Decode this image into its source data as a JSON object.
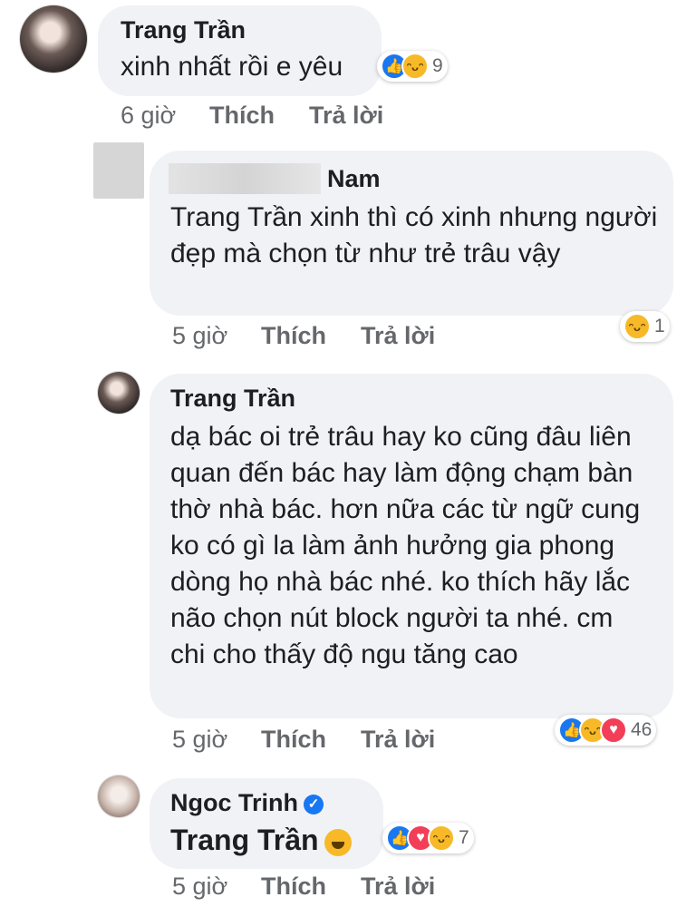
{
  "comments": [
    {
      "author": "Trang Trần",
      "text": "xinh nhất rồi e yêu",
      "time": "6 giờ",
      "like_label": "Thích",
      "reply_label": "Trả lời",
      "reaction_count": "9",
      "reactions": [
        "like-icon",
        "haha-icon"
      ]
    },
    {
      "author": "Nam",
      "text": "Trang Trần xinh thì có xinh nhưng người đẹp mà chọn từ như trẻ trâu vậy",
      "time": "5 giờ",
      "like_label": "Thích",
      "reply_label": "Trả lời",
      "reaction_count": "1",
      "reactions": [
        "haha-icon"
      ]
    },
    {
      "author": "Trang Trần",
      "text": "dạ bác oi trẻ trâu hay ko cũng đâu liên quan đến bác hay làm động chạm bàn thờ nhà bác. hơn nữa các từ ngữ cung ko có gì la làm ảnh hưởng gia phong dòng họ nhà bác nhé. ko thích hãy lắc não chọn nút block người ta nhé. cm chi cho thấy độ ngu tăng cao",
      "time": "5 giờ",
      "like_label": "Thích",
      "reply_label": "Trả lời",
      "reaction_count": "46",
      "reactions": [
        "like-icon",
        "haha-icon",
        "love-icon"
      ]
    },
    {
      "author": "Ngoc Trinh",
      "text": "Trang Trần",
      "time": "5 giờ",
      "like_label": "Thích",
      "reply_label": "Trả lời",
      "reaction_count": "7",
      "reactions": [
        "like-icon",
        "love-icon",
        "haha-icon"
      ]
    }
  ],
  "colors": {
    "bubble": "#f0f2f5",
    "like": "#1877f2",
    "love": "#f33e58",
    "haha": "#f7b928",
    "meta": "#65676b"
  }
}
